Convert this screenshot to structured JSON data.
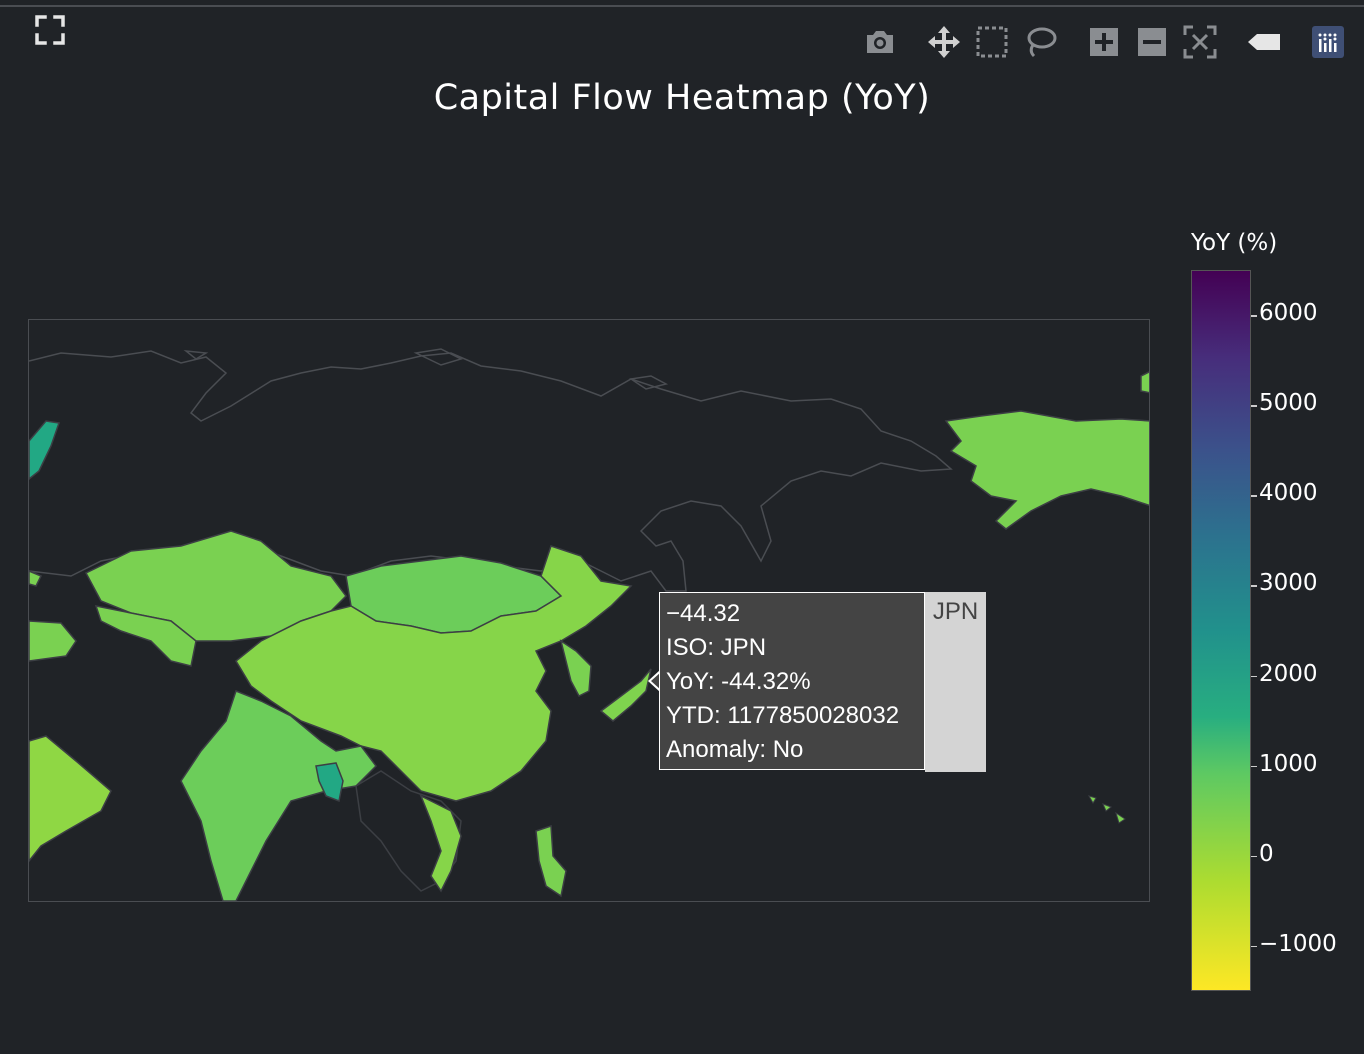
{
  "chart_data": {
    "type": "choropleth",
    "title": "Capital Flow Heatmap (YoY)",
    "colorbar": {
      "title": "YoY (%)",
      "range": [
        -1500,
        6500
      ],
      "ticks": [
        "6000",
        "5000",
        "4000",
        "3000",
        "2000",
        "1000",
        "0",
        "−1000"
      ],
      "tick_values": [
        6000,
        5000,
        4000,
        3000,
        2000,
        1000,
        0,
        -1000
      ],
      "colorscale": "Viridis (reversed)"
    },
    "hover": {
      "value_line": "−44.32",
      "iso_line": "ISO: JPN",
      "yoy_line": "YoY: -44.32%",
      "ytd_line": "YTD: 1177850028032",
      "anomaly_line": "Anomaly: No",
      "tag": "JPN"
    },
    "regions": [
      {
        "iso": "JPN",
        "yoy": -44.32,
        "color": "#7fd34e"
      },
      {
        "iso": "CHN",
        "color": "#86d549"
      },
      {
        "iso": "MNG",
        "color": "#6ccd5a"
      },
      {
        "iso": "KAZ",
        "color": "#7ad151"
      },
      {
        "iso": "IND",
        "color": "#6ccd5a"
      },
      {
        "iso": "BGD",
        "color": "#22a884"
      },
      {
        "iso": "USA",
        "color": "#7ad151"
      },
      {
        "iso": "NOR",
        "color": "#22a884"
      }
    ]
  },
  "modebar": {
    "buttons": [
      "camera-icon",
      "pan-icon",
      "box-select-icon",
      "lasso-icon",
      "zoom-in-icon",
      "zoom-out-icon",
      "autoscale-icon",
      "reset-icon",
      "plotly-logo-icon"
    ]
  },
  "colors": {
    "background": "#202327",
    "land_border": "#3c3f44",
    "tooltip_bg": "#444444"
  }
}
